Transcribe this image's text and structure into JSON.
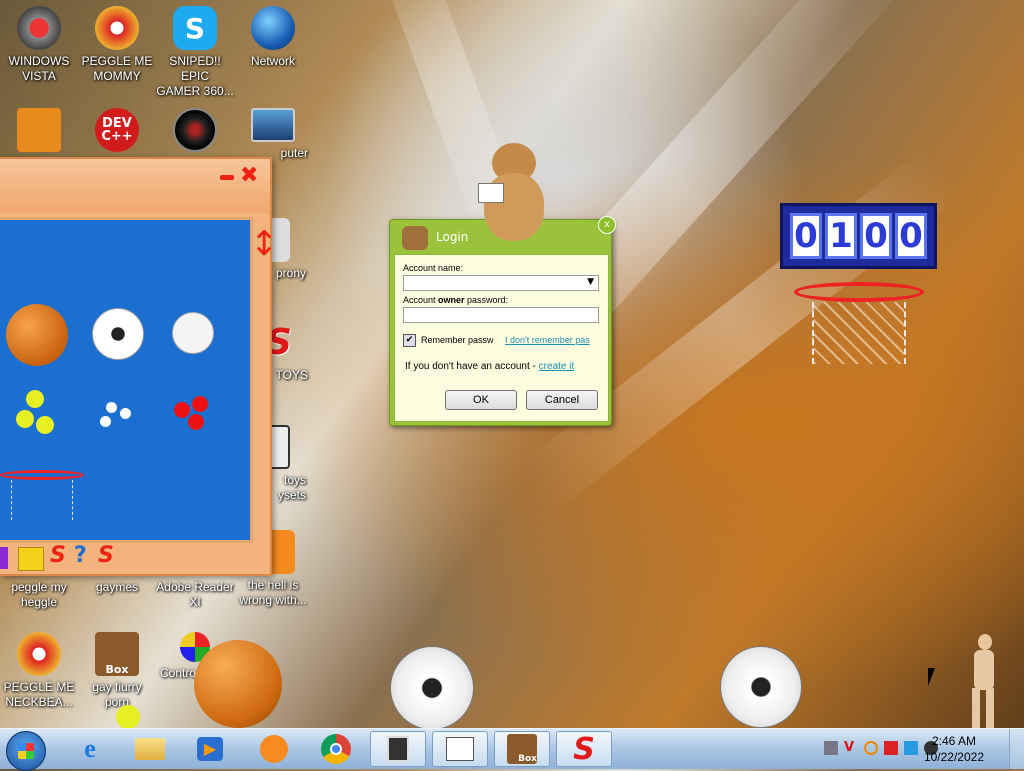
{
  "desktop": {
    "icons": [
      {
        "label": "WINDOWS\nVISTA"
      },
      {
        "label": "PEGGLE ME\nMOMMY"
      },
      {
        "label": "SNIPED!! EPIC\nGAMER 360..."
      },
      {
        "label": "Network"
      },
      {
        "label": "puter"
      },
      {
        "label": "prony"
      },
      {
        "label": "TOYS"
      },
      {
        "label": "toys\nysets"
      },
      {
        "label": "peggle my\nheggle"
      },
      {
        "label": "gaymes"
      },
      {
        "label": "Adobe Reader\nXI"
      },
      {
        "label": "the hell is\nwrong with..."
      },
      {
        "label": "PEGGLE ME\nNECKBEA..."
      },
      {
        "label": "gay fiurry\nporn"
      },
      {
        "label": "Contro"
      }
    ],
    "dev_icon_text": "DEV\nC++",
    "box_icon_text": "Box"
  },
  "login": {
    "title": "Login",
    "account_name_label": "Account name:",
    "password_label_pre": "Account ",
    "password_label_bold": "owner",
    "password_label_post": " password:",
    "remember_label": "Remember passw",
    "forgot_link": "I don't remember pas",
    "no_account_text": "If you don't have an account - ",
    "create_link": "create it",
    "ok_label": "OK",
    "cancel_label": "Cancel"
  },
  "scoreboard": {
    "digits": [
      "0",
      "1",
      "0",
      "0"
    ]
  },
  "taskbar": {
    "time": "2:46 AM",
    "date": "10/22/2022",
    "box_label": "Box"
  },
  "colors": {
    "dialog_green": "#9ac23a",
    "score_blue": "#1f2a9c",
    "gadget_orange": "#f3b37c"
  }
}
